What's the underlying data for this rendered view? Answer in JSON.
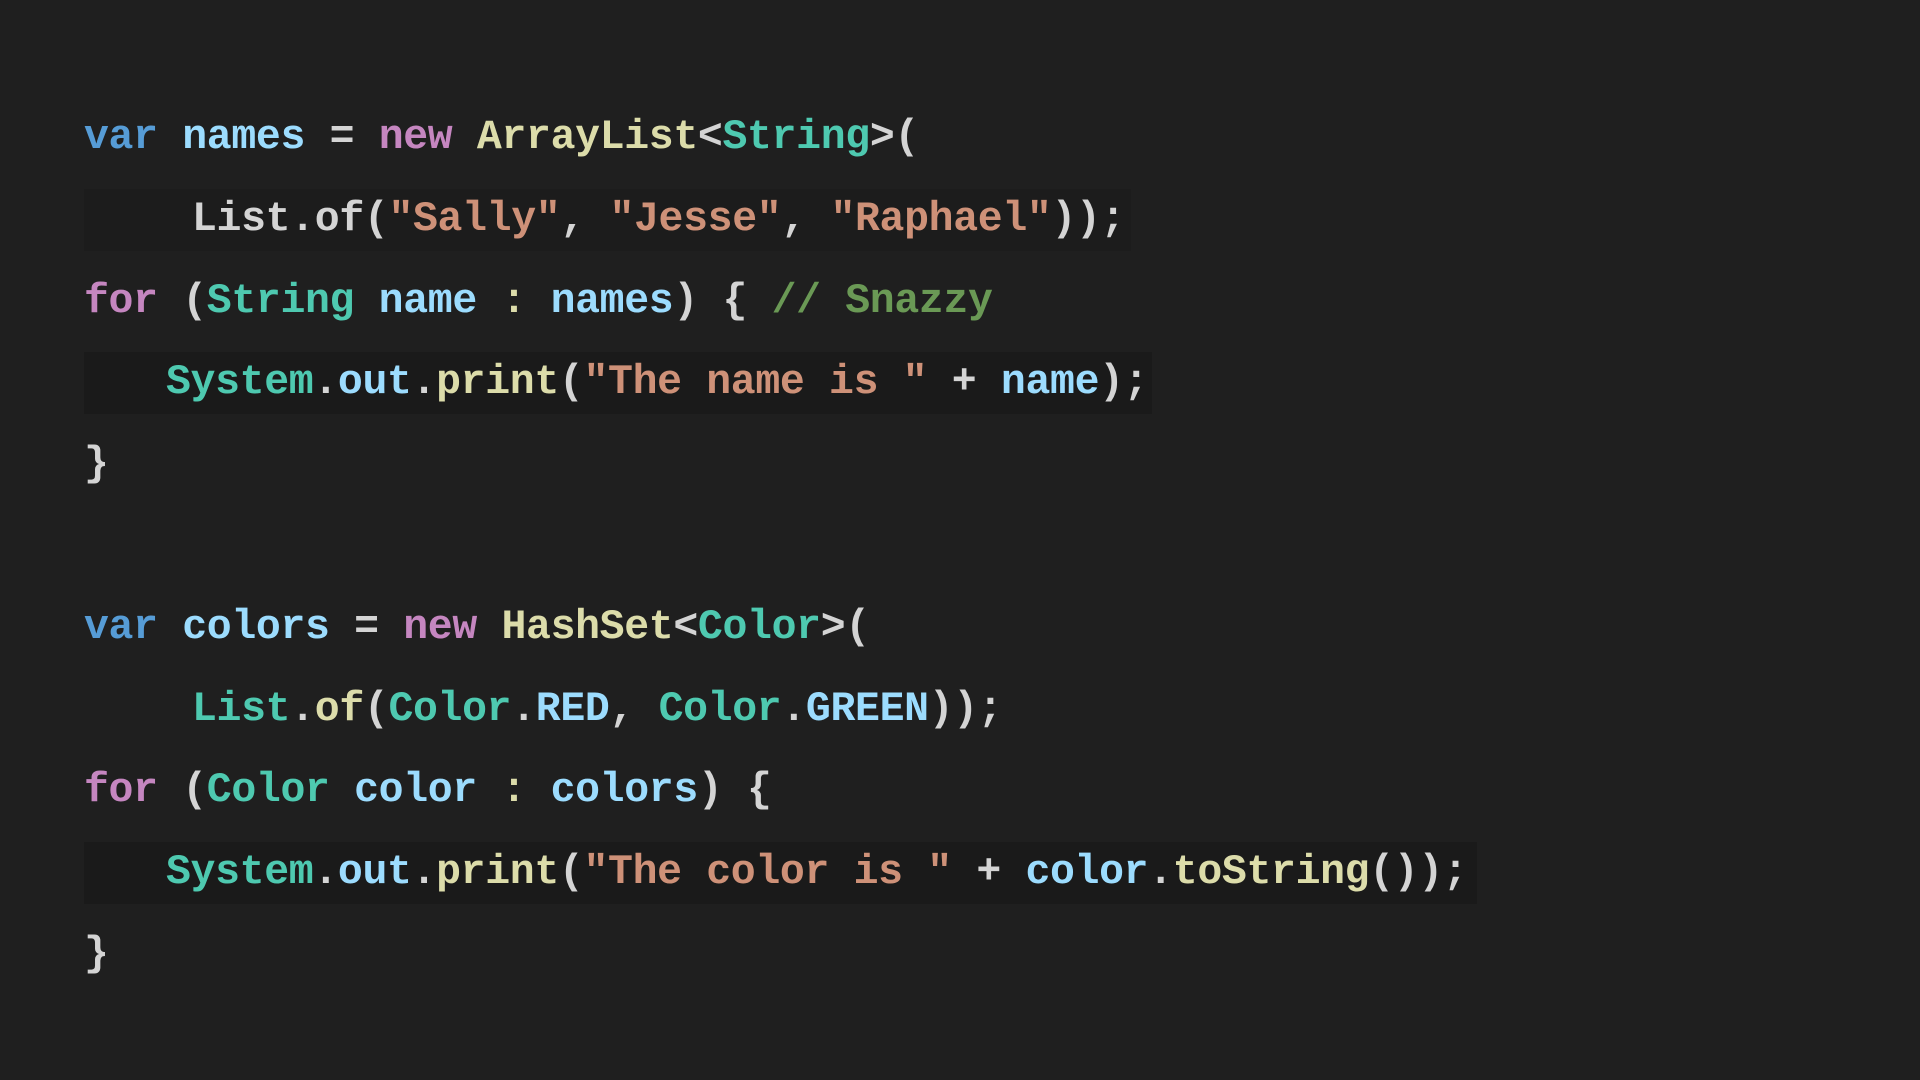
{
  "colors": {
    "background": "#1f1f1f",
    "keyword_storage": "#569cd6",
    "keyword_control": "#c586c0",
    "variable": "#9cdcfe",
    "type": "#4ec9b0",
    "function": "#dcdcaa",
    "string": "#ce9178",
    "comment": "#6a9955",
    "punctuation": "#d4d4d4"
  },
  "code": {
    "language": "java",
    "lines": [
      {
        "tokens": [
          {
            "text": "var",
            "kind": "storage"
          },
          {
            "text": " ",
            "kind": "plain"
          },
          {
            "text": "names",
            "kind": "variable"
          },
          {
            "text": " = ",
            "kind": "plain"
          },
          {
            "text": "new",
            "kind": "control"
          },
          {
            "text": " ",
            "kind": "plain"
          },
          {
            "text": "ArrayList",
            "kind": "function"
          },
          {
            "text": "<",
            "kind": "plain"
          },
          {
            "text": "String",
            "kind": "type"
          },
          {
            "text": ">(",
            "kind": "plain"
          }
        ]
      },
      {
        "tokens": [
          {
            "text": "List",
            "kind": "plain"
          },
          {
            "text": ".",
            "kind": "plain"
          },
          {
            "text": "of",
            "kind": "plain"
          },
          {
            "text": "(",
            "kind": "plain"
          },
          {
            "text": "\"Sally\"",
            "kind": "string"
          },
          {
            "text": ", ",
            "kind": "plain"
          },
          {
            "text": "\"Jesse\"",
            "kind": "string"
          },
          {
            "text": ", ",
            "kind": "plain"
          },
          {
            "text": "\"Raphael\"",
            "kind": "string"
          },
          {
            "text": "));",
            "kind": "plain"
          }
        ]
      },
      {
        "tokens": [
          {
            "text": "for",
            "kind": "control"
          },
          {
            "text": " (",
            "kind": "plain"
          },
          {
            "text": "String",
            "kind": "type"
          },
          {
            "text": " ",
            "kind": "plain"
          },
          {
            "text": "name",
            "kind": "variable"
          },
          {
            "text": " : ",
            "kind": "function"
          },
          {
            "text": "names",
            "kind": "variable"
          },
          {
            "text": ") { ",
            "kind": "plain"
          },
          {
            "text": "// Snazzy",
            "kind": "comment"
          }
        ]
      },
      {
        "tokens": [
          {
            "text": "System",
            "kind": "type"
          },
          {
            "text": ".",
            "kind": "plain"
          },
          {
            "text": "out",
            "kind": "variable"
          },
          {
            "text": ".",
            "kind": "plain"
          },
          {
            "text": "print",
            "kind": "function"
          },
          {
            "text": "(",
            "kind": "plain"
          },
          {
            "text": "\"The name is \"",
            "kind": "string"
          },
          {
            "text": " + ",
            "kind": "plain"
          },
          {
            "text": "name",
            "kind": "variable"
          },
          {
            "text": ");",
            "kind": "plain"
          }
        ]
      },
      {
        "tokens": [
          {
            "text": "}",
            "kind": "plain"
          }
        ]
      },
      {
        "tokens": []
      },
      {
        "tokens": [
          {
            "text": "var",
            "kind": "storage"
          },
          {
            "text": " ",
            "kind": "plain"
          },
          {
            "text": "colors",
            "kind": "variable"
          },
          {
            "text": " = ",
            "kind": "plain"
          },
          {
            "text": "new",
            "kind": "control"
          },
          {
            "text": " ",
            "kind": "plain"
          },
          {
            "text": "HashSet",
            "kind": "function"
          },
          {
            "text": "<",
            "kind": "plain"
          },
          {
            "text": "Color",
            "kind": "type"
          },
          {
            "text": ">(",
            "kind": "plain"
          }
        ]
      },
      {
        "tokens": [
          {
            "text": "List",
            "kind": "type"
          },
          {
            "text": ".",
            "kind": "plain"
          },
          {
            "text": "of",
            "kind": "function"
          },
          {
            "text": "(",
            "kind": "plain"
          },
          {
            "text": "Color",
            "kind": "type"
          },
          {
            "text": ".",
            "kind": "plain"
          },
          {
            "text": "RED",
            "kind": "variable"
          },
          {
            "text": ", ",
            "kind": "plain"
          },
          {
            "text": "Color",
            "kind": "type"
          },
          {
            "text": ".",
            "kind": "plain"
          },
          {
            "text": "GREEN",
            "kind": "variable"
          },
          {
            "text": "));",
            "kind": "plain"
          }
        ]
      },
      {
        "tokens": [
          {
            "text": "for",
            "kind": "control"
          },
          {
            "text": " (",
            "kind": "plain"
          },
          {
            "text": "Color",
            "kind": "type"
          },
          {
            "text": " ",
            "kind": "plain"
          },
          {
            "text": "color",
            "kind": "variable"
          },
          {
            "text": " : ",
            "kind": "function"
          },
          {
            "text": "colors",
            "kind": "variable"
          },
          {
            "text": ") {",
            "kind": "plain"
          }
        ]
      },
      {
        "tokens": [
          {
            "text": "System",
            "kind": "type"
          },
          {
            "text": ".",
            "kind": "plain"
          },
          {
            "text": "out",
            "kind": "variable"
          },
          {
            "text": ".",
            "kind": "plain"
          },
          {
            "text": "print",
            "kind": "function"
          },
          {
            "text": "(",
            "kind": "plain"
          },
          {
            "text": "\"The color is \"",
            "kind": "string"
          },
          {
            "text": " + ",
            "kind": "plain"
          },
          {
            "text": "color",
            "kind": "variable"
          },
          {
            "text": ".",
            "kind": "plain"
          },
          {
            "text": "toString",
            "kind": "function"
          },
          {
            "text": "());",
            "kind": "plain"
          }
        ]
      },
      {
        "tokens": [
          {
            "text": "}",
            "kind": "plain"
          }
        ]
      }
    ]
  }
}
